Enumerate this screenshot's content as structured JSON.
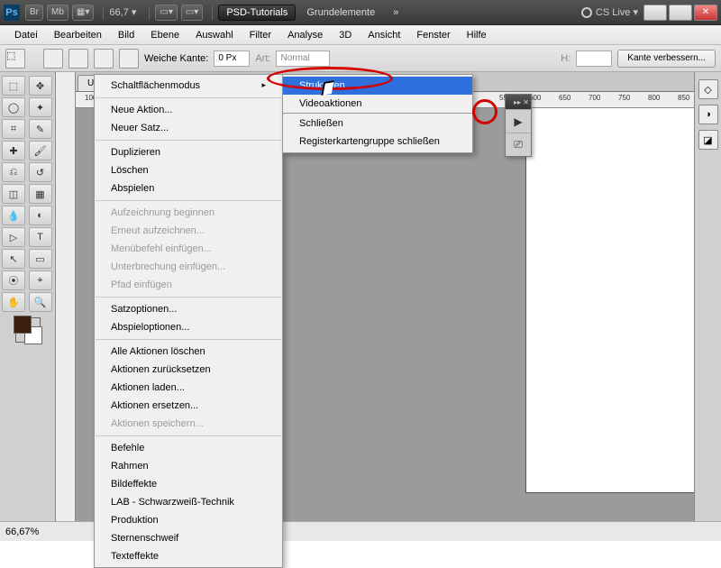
{
  "titlebar": {
    "logo": "Ps",
    "btns": [
      "Br",
      "Mb",
      "▦▾"
    ],
    "zoom": "66,7 ▾",
    "view_icon": "▭▾",
    "screen_icon": "▭▾",
    "doc_active": "PSD-Tutorials",
    "doc_inactive": "Grundelemente",
    "more": "»",
    "cslive": "CS Live ▾"
  },
  "menubar": [
    "Datei",
    "Bearbeiten",
    "Bild",
    "Ebene",
    "Auswahl",
    "Filter",
    "Analyse",
    "3D",
    "Ansicht",
    "Fenster",
    "Hilfe"
  ],
  "optbar": {
    "weiche_label": "Weiche Kante:",
    "weiche_val": "0 Px",
    "art_label": "Art:",
    "art_val": "Normal",
    "h_label": "H:",
    "refine": "Kante verbessern..."
  },
  "doc_tab": "Unbe…",
  "ruler_marks": [
    100,
    550,
    600,
    650,
    700,
    750,
    800,
    850
  ],
  "ctx_menu": {
    "items": [
      {
        "t": "Schaltflächenmodus",
        "sub": true
      },
      {
        "sep": true
      },
      {
        "t": "Neue Aktion..."
      },
      {
        "t": "Neuer Satz..."
      },
      {
        "sep": true
      },
      {
        "t": "Duplizieren"
      },
      {
        "t": "Löschen"
      },
      {
        "t": "Abspielen"
      },
      {
        "sep": true
      },
      {
        "t": "Aufzeichnung beginnen",
        "d": true
      },
      {
        "t": "Erneut aufzeichnen...",
        "d": true
      },
      {
        "t": "Menübefehl einfügen...",
        "d": true
      },
      {
        "t": "Unterbrechung einfügen...",
        "d": true
      },
      {
        "t": "Pfad einfügen",
        "d": true
      },
      {
        "sep": true
      },
      {
        "t": "Satzoptionen..."
      },
      {
        "t": "Abspieloptionen..."
      },
      {
        "sep": true
      },
      {
        "t": "Alle Aktionen löschen"
      },
      {
        "t": "Aktionen zurücksetzen"
      },
      {
        "t": "Aktionen laden..."
      },
      {
        "t": "Aktionen ersetzen..."
      },
      {
        "t": "Aktionen speichern...",
        "d": true
      },
      {
        "sep": true
      },
      {
        "t": "Befehle"
      },
      {
        "t": "Rahmen"
      },
      {
        "t": "Bildeffekte"
      },
      {
        "t": "LAB - Schwarzweiß-Technik"
      },
      {
        "t": "Produktion"
      },
      {
        "t": "Sternenschweif"
      },
      {
        "t": "Texteffekte"
      }
    ]
  },
  "submenu": {
    "items": [
      {
        "t": "Strukturen",
        "sel": true
      },
      {
        "t": "Videoaktionen"
      },
      {
        "sep": true
      },
      {
        "t": "Schließen"
      },
      {
        "t": "Registerkartengruppe schließen"
      }
    ]
  },
  "status": {
    "zoom": "66,67%"
  },
  "rpanel_icons": [
    "◇",
    "◑",
    "◪"
  ],
  "actions_icons": [
    "▶",
    "⎚"
  ]
}
